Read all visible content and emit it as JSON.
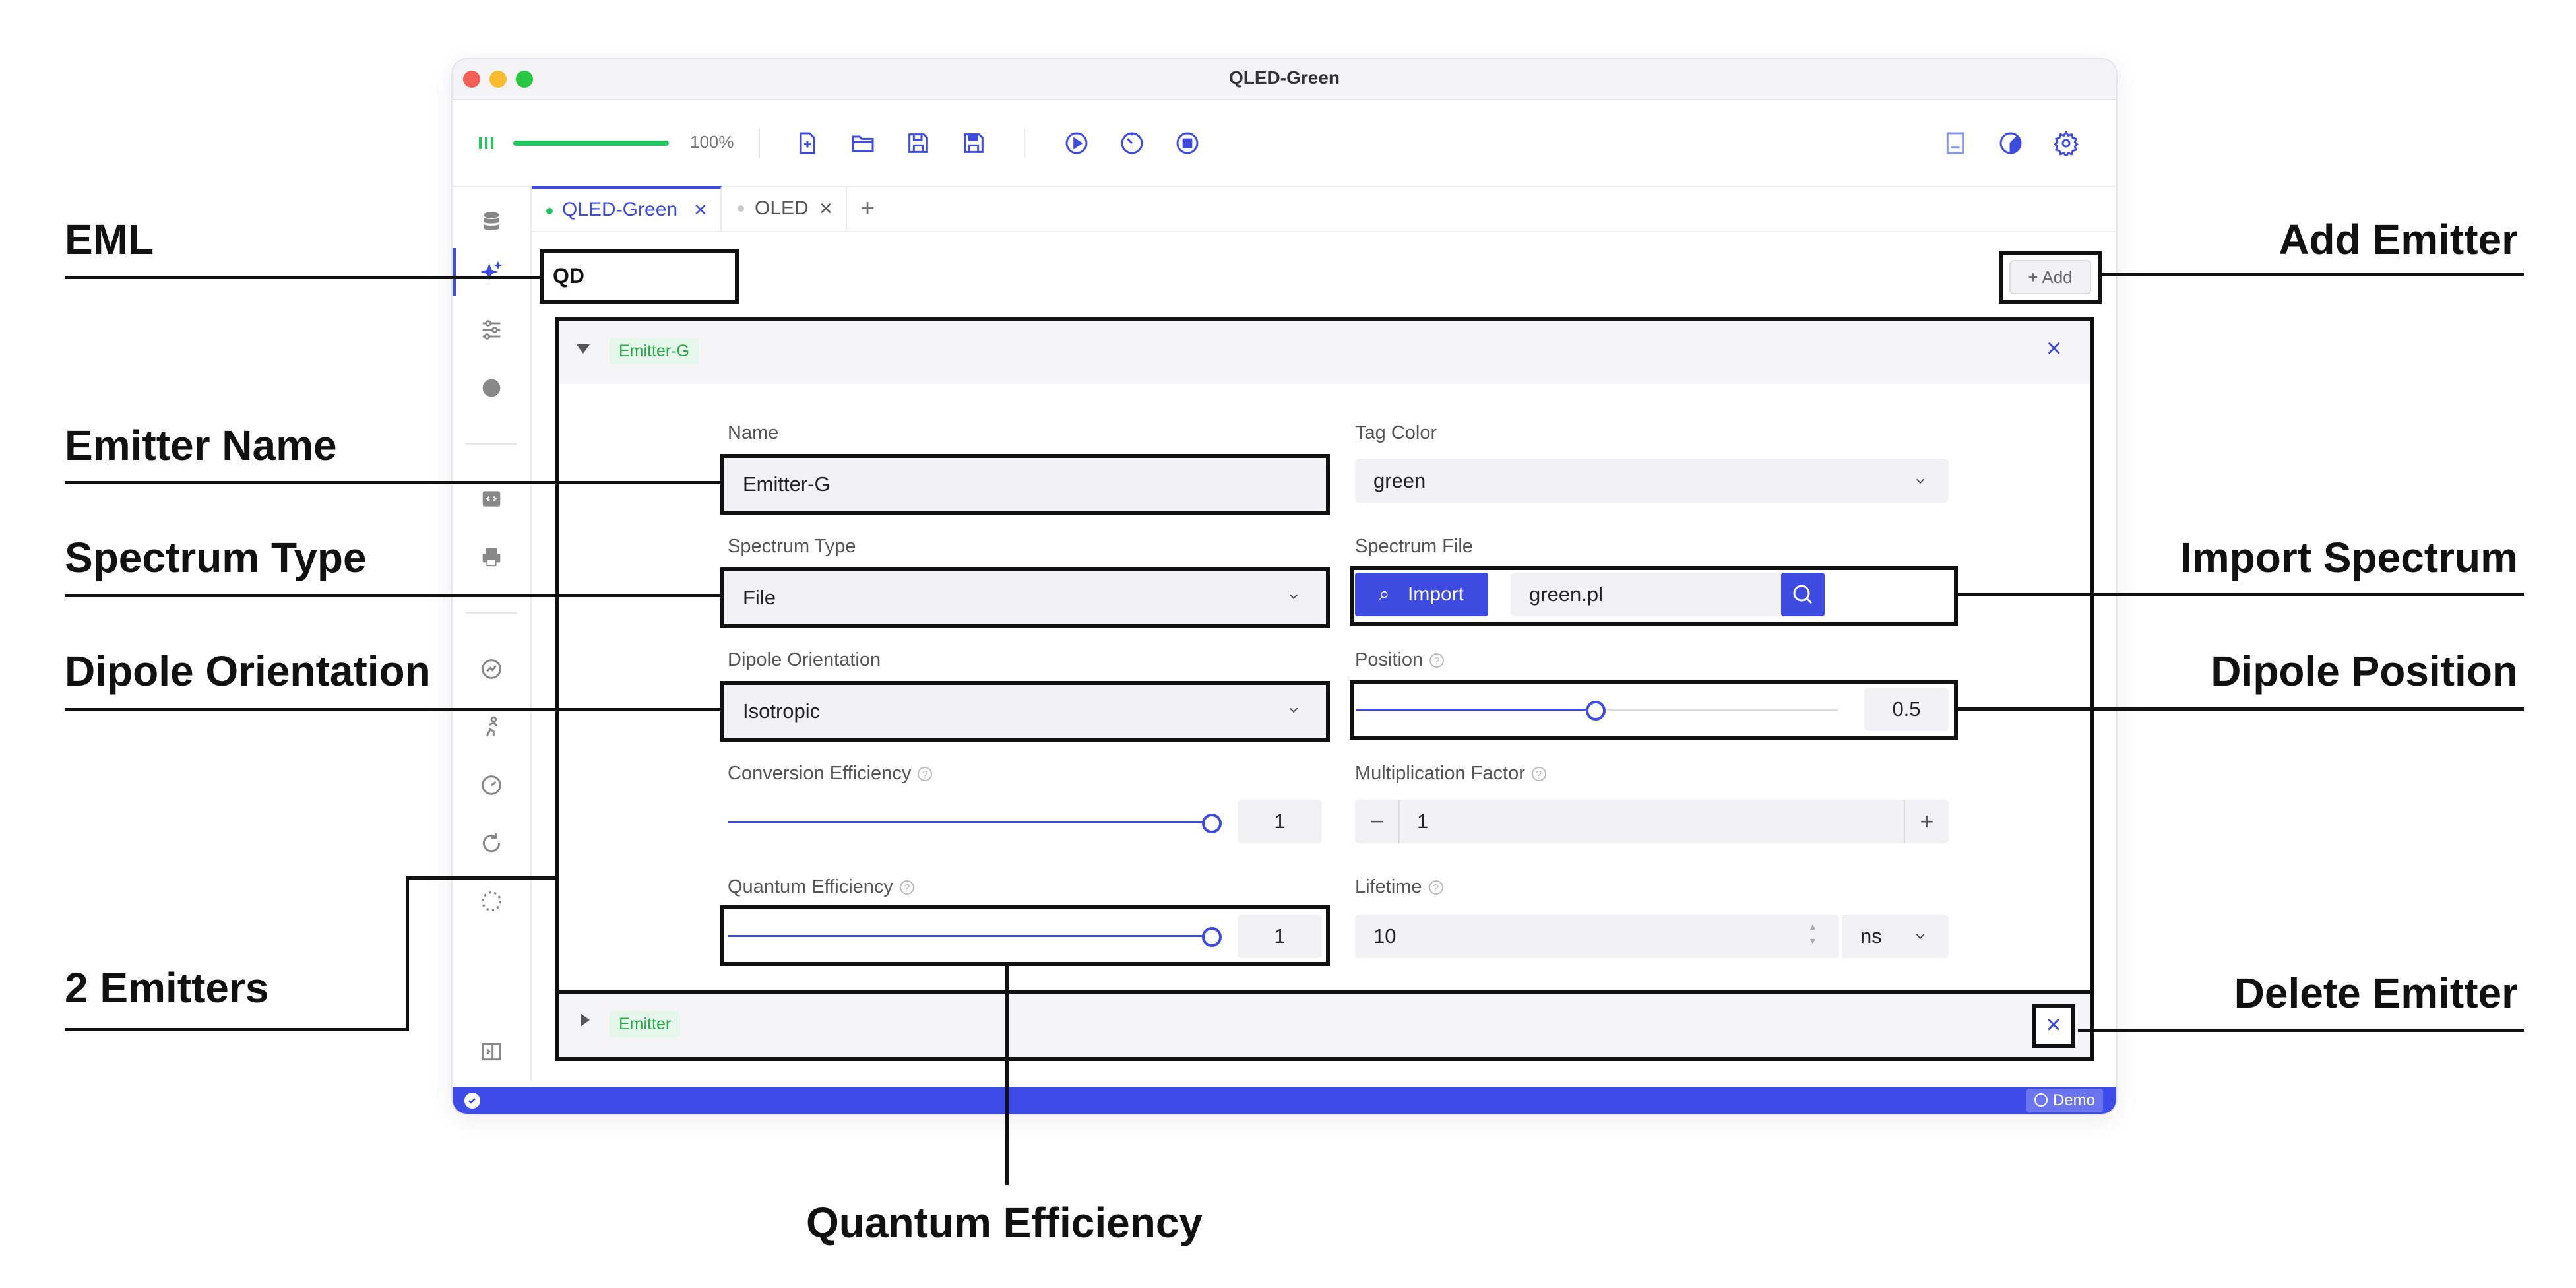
{
  "window": {
    "title": "QLED-Green",
    "zoom": "100%",
    "zoom_progress": 1.0
  },
  "tabs": [
    {
      "label": "QLED-Green",
      "active": true
    },
    {
      "label": "OLED",
      "active": false
    },
    {
      "label": "+"
    }
  ],
  "eml": {
    "value": "QD"
  },
  "add_button": {
    "label": "+ Add"
  },
  "emitters": [
    {
      "badge": "Emitter-G",
      "expanded": true,
      "name_label": "Name",
      "name_value": "Emitter-G",
      "tag_color_label": "Tag Color",
      "tag_color_value": "green",
      "spectrum_type_label": "Spectrum Type",
      "spectrum_type_value": "File",
      "spectrum_file_label": "Spectrum File",
      "import_label": "Import",
      "spectrum_file_value": "green.pl",
      "dipole_label": "Dipole Orientation",
      "dipole_value": "Isotropic",
      "position_label": "Position",
      "position_value": "0.5",
      "conversion_label": "Conversion Efficiency",
      "conversion_value": "1",
      "multiplication_label": "Multiplication Factor",
      "multiplication_value": "1",
      "qe_label": "Quantum Efficiency",
      "qe_value": "1",
      "lifetime_label": "Lifetime",
      "lifetime_value": "10",
      "lifetime_unit": "ns"
    },
    {
      "badge": "Emitter",
      "expanded": false
    }
  ],
  "status": {
    "demo_label": "Demo"
  },
  "annotations": {
    "eml": "EML",
    "emitter_name": "Emitter Name",
    "spectrum_type": "Spectrum Type",
    "dipole_orientation": "Dipole Orientation",
    "two_emitters": "2 Emitters",
    "quantum_efficiency": "Quantum Efficiency",
    "add_emitter": "Add Emitter",
    "import_spectrum": "Import Spectrum",
    "dipole_position": "Dipole Position",
    "delete_emitter": "Delete Emitter"
  },
  "colors": {
    "accent": "#3d4be0",
    "badge_bg": "#e5f7ea",
    "badge_fg": "#2aa84a",
    "progress": "#22c55e",
    "status_bar": "#3d4be8"
  }
}
